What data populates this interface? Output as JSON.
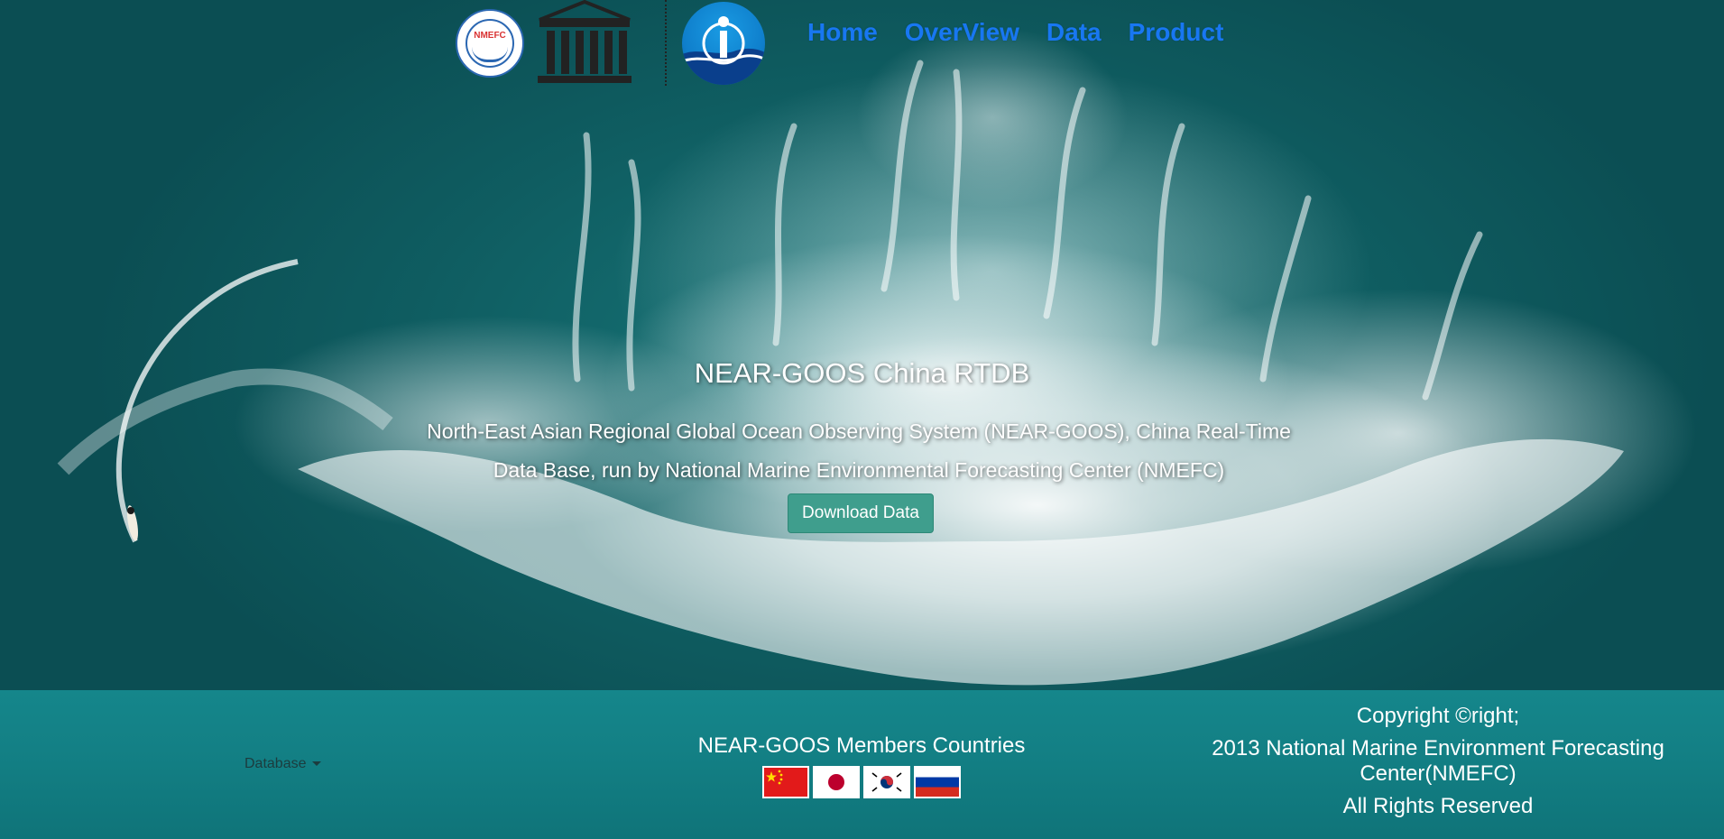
{
  "header": {
    "logos": {
      "nmefc_text": "NMEFC",
      "unesco_text": "UNESCO"
    },
    "nav": [
      {
        "label": "Home"
      },
      {
        "label": "OverView"
      },
      {
        "label": "Data"
      },
      {
        "label": "Product"
      }
    ],
    "nav_color": "#1877f2"
  },
  "hero": {
    "title": "NEAR-GOOS China RTDB",
    "description": "North-East Asian Regional Global Ocean Observing System (NEAR-GOOS), China Real-Time Data Base, run by National Marine Environmental Forecasting Center (NMEFC)",
    "download_button": "Download Data",
    "button_color": "#3f9e8d"
  },
  "footer": {
    "dropdown_label": "Database",
    "members_title": "NEAR-GOOS Members Countries",
    "flags": [
      {
        "icon": "china-flag-icon"
      },
      {
        "icon": "japan-flag-icon"
      },
      {
        "icon": "korea-flag-icon"
      },
      {
        "icon": "russia-flag-icon"
      }
    ],
    "copyright_line1": "Copyright ©right;",
    "copyright_line2": "2013 National Marine Environment Forecasting Center(NMEFC)",
    "copyright_line3": "All Rights Reserved"
  }
}
